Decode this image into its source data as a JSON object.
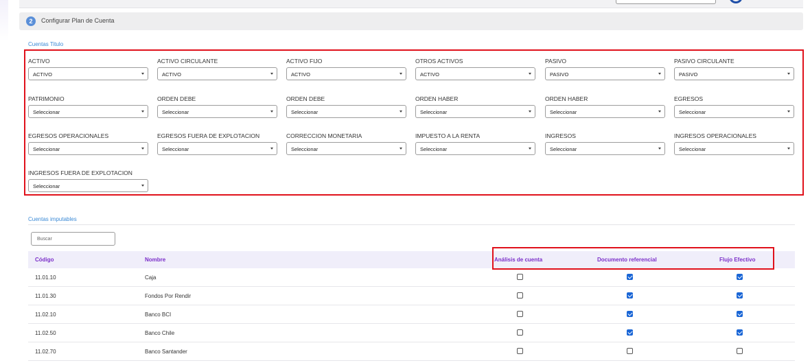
{
  "step": {
    "number": "2",
    "title": "Configurar Plan de Cuenta"
  },
  "cuentas_titulo": {
    "heading": "Cuentas Titulo",
    "fields": [
      {
        "label": "ACTIVO",
        "value": "ACTIVO"
      },
      {
        "label": "ACTIVO CIRCULANTE",
        "value": "ACTIVO"
      },
      {
        "label": "ACTIVO FIJO",
        "value": "ACTIVO"
      },
      {
        "label": "OTROS ACTIVOS",
        "value": "ACTIVO"
      },
      {
        "label": "PASIVO",
        "value": "PASIVO"
      },
      {
        "label": "PASIVO CIRCULANTE",
        "value": "PASIVO"
      },
      {
        "label": "PATRIMONIO",
        "value": "Seleccionar"
      },
      {
        "label": "ORDEN DEBE",
        "value": "Seleccionar"
      },
      {
        "label": "ORDEN DEBE",
        "value": "Seleccionar"
      },
      {
        "label": "ORDEN HABER",
        "value": "Seleccionar"
      },
      {
        "label": "ORDEN HABER",
        "value": "Seleccionar"
      },
      {
        "label": "EGRESOS",
        "value": "Seleccionar"
      },
      {
        "label": "EGRESOS OPERACIONALES",
        "value": "Seleccionar"
      },
      {
        "label": "EGRESOS FUERA DE EXPLOTACION",
        "value": "Seleccionar"
      },
      {
        "label": "CORRECCION MONETARIA",
        "value": "Seleccionar"
      },
      {
        "label": "IMPUESTO A LA RENTA",
        "value": "Seleccionar"
      },
      {
        "label": "INGRESOS",
        "value": "Seleccionar"
      },
      {
        "label": "INGRESOS OPERACIONALES",
        "value": "Seleccionar"
      },
      {
        "label": "INGRESOS FUERA DE EXPLOTACION",
        "value": "Seleccionar"
      }
    ]
  },
  "cuentas_imputables": {
    "heading": "Cuentas imputables",
    "search_placeholder": "Buscar",
    "columns": [
      "Código",
      "Nombre",
      "Análisis de cuenta",
      "Documento referencial",
      "Flujo Efectivo"
    ],
    "rows": [
      {
        "codigo": "11.01.10",
        "nombre": "Caja",
        "analisis": false,
        "documento": true,
        "flujo": true
      },
      {
        "codigo": "11.01.30",
        "nombre": "Fondos Por Rendir",
        "analisis": false,
        "documento": true,
        "flujo": true
      },
      {
        "codigo": "11.02.10",
        "nombre": "Banco BCI",
        "analisis": false,
        "documento": true,
        "flujo": true
      },
      {
        "codigo": "11.02.50",
        "nombre": "Banco Chile",
        "analisis": false,
        "documento": true,
        "flujo": true
      },
      {
        "codigo": "11.02.70",
        "nombre": "Banco Santander",
        "analisis": false,
        "documento": false,
        "flujo": false
      }
    ]
  },
  "colors": {
    "accent": "#3b8ad6",
    "header_text": "#7b2fc9",
    "highlight": "#e0101a",
    "checkbox_on": "#1a66d6"
  }
}
